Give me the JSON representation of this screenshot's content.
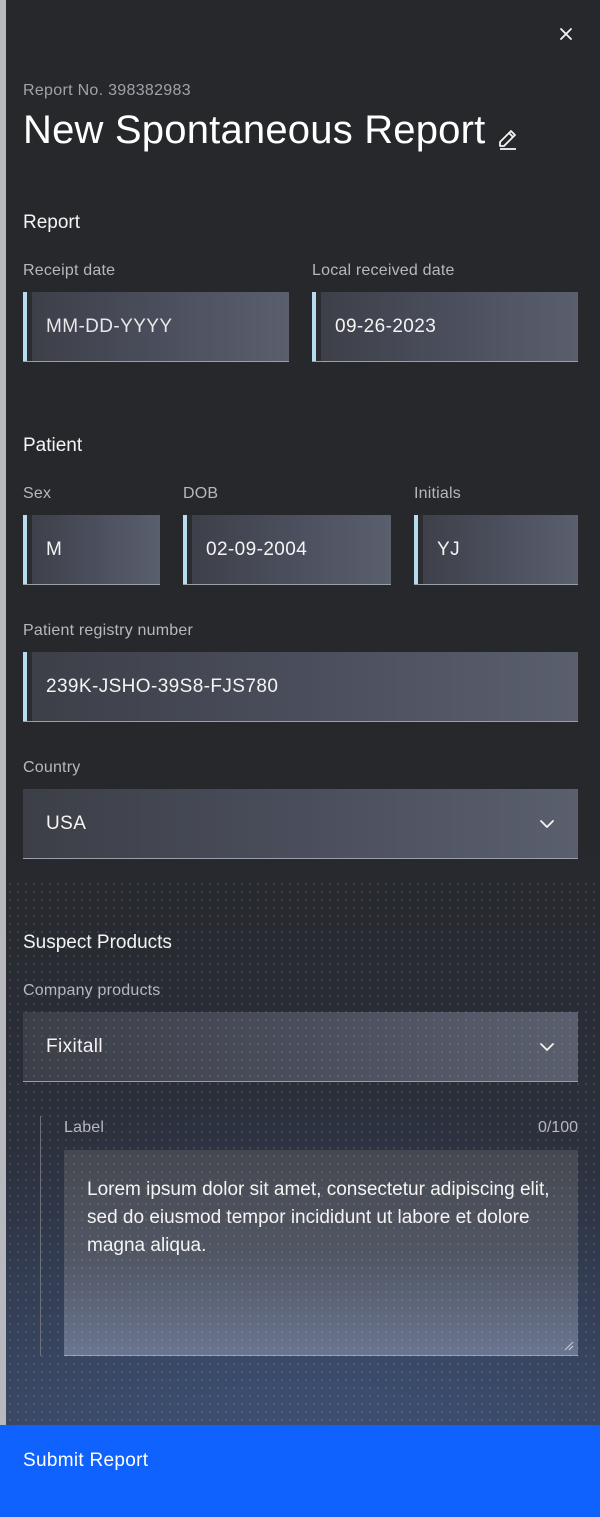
{
  "header": {
    "report_no": "Report No. 398382983",
    "title": "New Spontaneous Report"
  },
  "report": {
    "heading": "Report",
    "receipt_date_label": "Receipt date",
    "receipt_date_placeholder": "MM-DD-YYYY",
    "local_received_label": "Local received date",
    "local_received_value": "09-26-2023"
  },
  "patient": {
    "heading": "Patient",
    "sex_label": "Sex",
    "sex_value": "M",
    "dob_label": "DOB",
    "dob_value": "02-09-2004",
    "initials_label": "Initials",
    "initials_value": "YJ",
    "registry_label": "Patient registry number",
    "registry_value": "239K-JSHO-39S8-FJS780",
    "country_label": "Country",
    "country_value": "USA"
  },
  "products": {
    "heading": "Suspect Products",
    "company_label": "Company products",
    "company_value": "Fixitall",
    "textarea_label": "Label",
    "textarea_counter": "0/100",
    "textarea_value": "Lorem ipsum dolor sit amet, consectetur adipiscing elit, sed do eiusmod tempor incididunt ut labore et dolore magna aliqua."
  },
  "footer": {
    "submit_label": "Submit Report"
  },
  "colors": {
    "accent": "#0f62fe",
    "field_marker": "#b6dcee"
  },
  "icons": [
    "close-icon",
    "pencil-icon",
    "chevron-down-icon",
    "resize-handle-icon"
  ]
}
